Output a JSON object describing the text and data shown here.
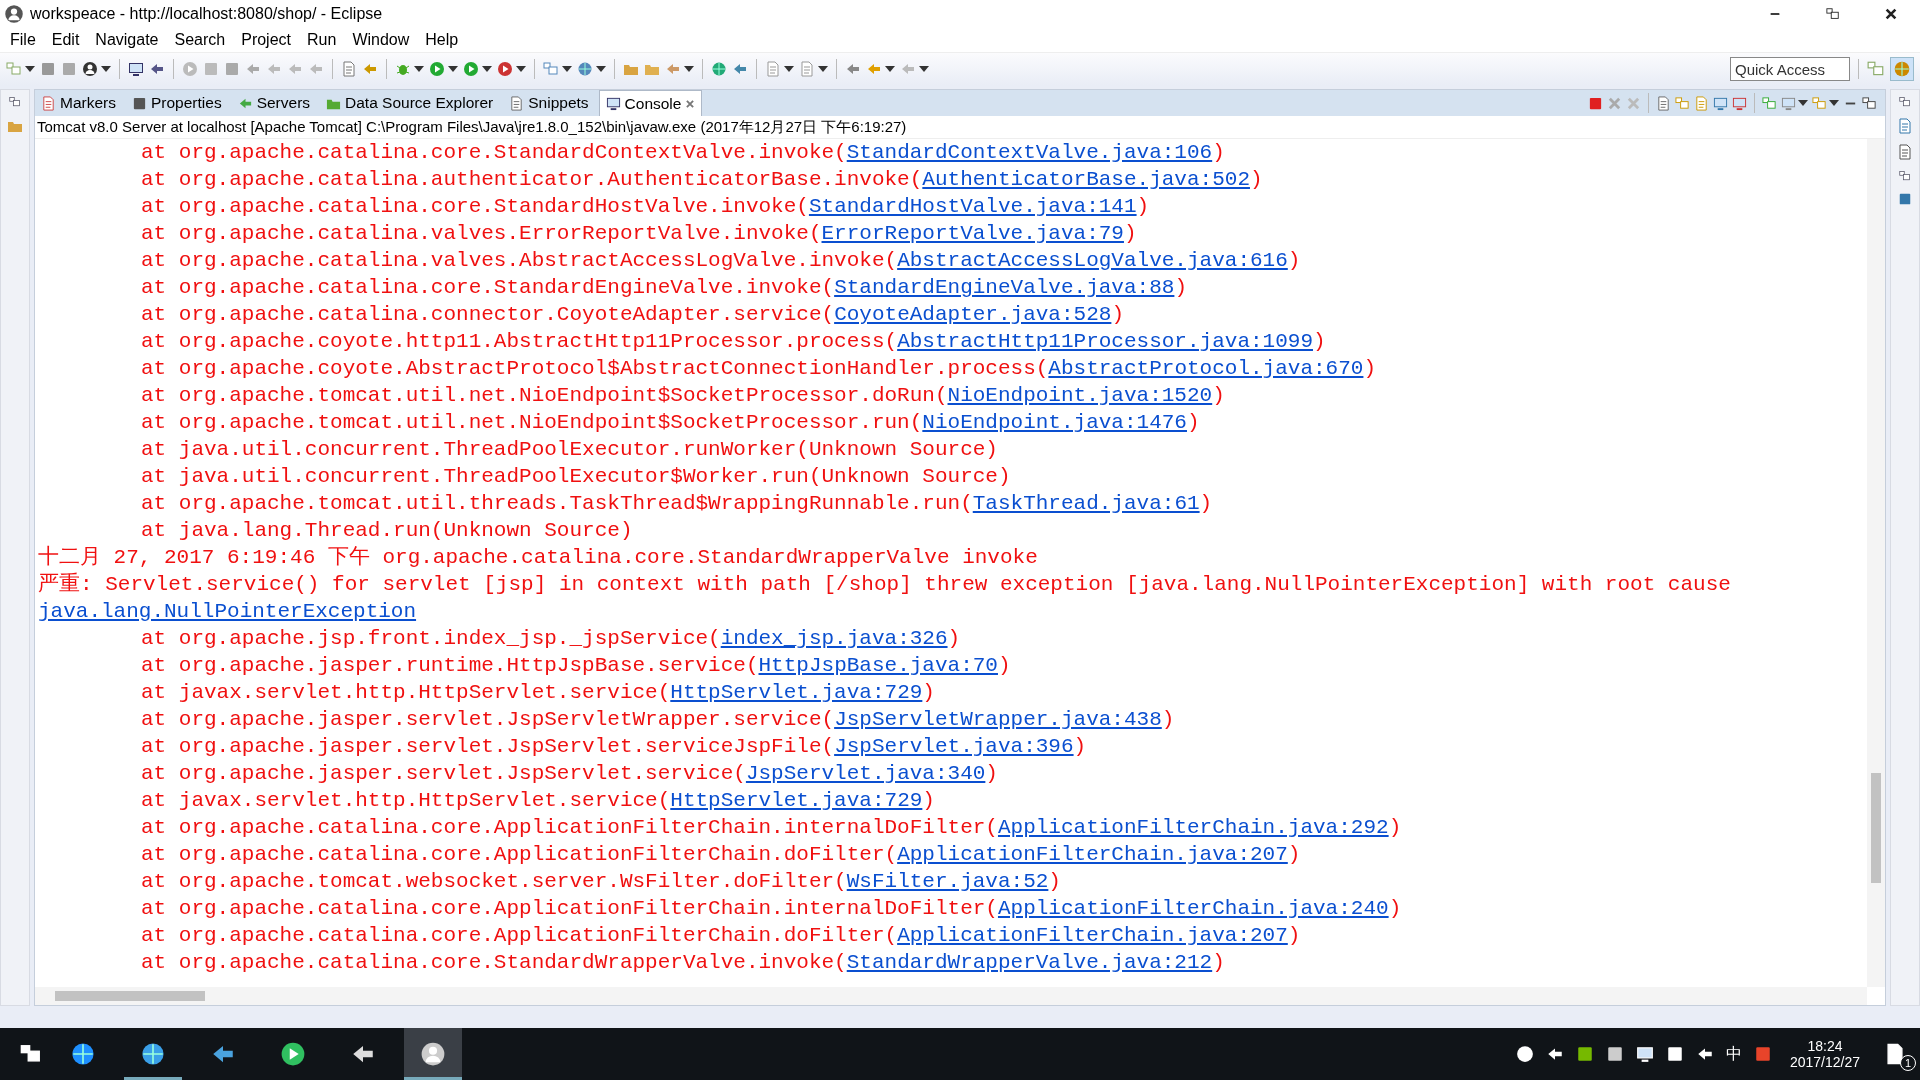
{
  "window": {
    "title": "workspeace - http://localhost:8080/shop/ - Eclipse"
  },
  "menu": [
    "File",
    "Edit",
    "Navigate",
    "Search",
    "Project",
    "Run",
    "Window",
    "Help"
  ],
  "quick_access": {
    "placeholder": "Quick Access"
  },
  "tabs": [
    {
      "label": "Markers",
      "selected": false,
      "closable": false
    },
    {
      "label": "Properties",
      "selected": false,
      "closable": false
    },
    {
      "label": "Servers",
      "selected": false,
      "closable": false
    },
    {
      "label": "Data Source Explorer",
      "selected": false,
      "closable": false
    },
    {
      "label": "Snippets",
      "selected": false,
      "closable": false
    },
    {
      "label": "Console",
      "selected": true,
      "closable": true
    }
  ],
  "console": {
    "header": "Tomcat v8.0 Server at localhost [Apache Tomcat] C:\\Program Files\\Java\\jre1.8.0_152\\bin\\javaw.exe (2017年12月27日 下午6:19:27)",
    "lines": [
      {
        "kind": "frame",
        "text": "at org.apache.catalina.core.StandardContextValve.invoke(",
        "link": "StandardContextValve.java:106",
        "tail": ")"
      },
      {
        "kind": "frame",
        "text": "at org.apache.catalina.authenticator.AuthenticatorBase.invoke(",
        "link": "AuthenticatorBase.java:502",
        "tail": ")"
      },
      {
        "kind": "frame",
        "text": "at org.apache.catalina.core.StandardHostValve.invoke(",
        "link": "StandardHostValve.java:141",
        "tail": ")"
      },
      {
        "kind": "frame",
        "text": "at org.apache.catalina.valves.ErrorReportValve.invoke(",
        "link": "ErrorReportValve.java:79",
        "tail": ")"
      },
      {
        "kind": "frame",
        "text": "at org.apache.catalina.valves.AbstractAccessLogValve.invoke(",
        "link": "AbstractAccessLogValve.java:616",
        "tail": ")"
      },
      {
        "kind": "frame",
        "text": "at org.apache.catalina.core.StandardEngineValve.invoke(",
        "link": "StandardEngineValve.java:88",
        "tail": ")"
      },
      {
        "kind": "frame",
        "text": "at org.apache.catalina.connector.CoyoteAdapter.service(",
        "link": "CoyoteAdapter.java:528",
        "tail": ")"
      },
      {
        "kind": "frame",
        "text": "at org.apache.coyote.http11.AbstractHttp11Processor.process(",
        "link": "AbstractHttp11Processor.java:1099",
        "tail": ")"
      },
      {
        "kind": "frame",
        "text": "at org.apache.coyote.AbstractProtocol$AbstractConnectionHandler.process(",
        "link": "AbstractProtocol.java:670",
        "tail": ")"
      },
      {
        "kind": "frame",
        "text": "at org.apache.tomcat.util.net.NioEndpoint$SocketProcessor.doRun(",
        "link": "NioEndpoint.java:1520",
        "tail": ")"
      },
      {
        "kind": "frame",
        "text": "at org.apache.tomcat.util.net.NioEndpoint$SocketProcessor.run(",
        "link": "NioEndpoint.java:1476",
        "tail": ")"
      },
      {
        "kind": "frame",
        "text": "at java.util.concurrent.ThreadPoolExecutor.runWorker(Unknown Source)"
      },
      {
        "kind": "frame",
        "text": "at java.util.concurrent.ThreadPoolExecutor$Worker.run(Unknown Source)"
      },
      {
        "kind": "frame",
        "text": "at org.apache.tomcat.util.threads.TaskThread$WrappingRunnable.run(",
        "link": "TaskThread.java:61",
        "tail": ")"
      },
      {
        "kind": "frame",
        "text": "at java.lang.Thread.run(Unknown Source)"
      },
      {
        "kind": "log",
        "text": "十二月 27, 2017 6:19:46 下午 org.apache.catalina.core.StandardWrapperValve invoke"
      },
      {
        "kind": "log",
        "text": "严重: Servlet.service() for servlet [jsp] in context with path [/shop] threw exception [java.lang.NullPointerException] with root cause"
      },
      {
        "kind": "link",
        "link": "java.lang.NullPointerException"
      },
      {
        "kind": "frame",
        "text": "at org.apache.jsp.front.index_jsp._jspService(",
        "link": "index_jsp.java:326",
        "tail": ")"
      },
      {
        "kind": "frame",
        "text": "at org.apache.jasper.runtime.HttpJspBase.service(",
        "link": "HttpJspBase.java:70",
        "tail": ")"
      },
      {
        "kind": "frame",
        "text": "at javax.servlet.http.HttpServlet.service(",
        "link": "HttpServlet.java:729",
        "tail": ")"
      },
      {
        "kind": "frame",
        "text": "at org.apache.jasper.servlet.JspServletWrapper.service(",
        "link": "JspServletWrapper.java:438",
        "tail": ")"
      },
      {
        "kind": "frame",
        "text": "at org.apache.jasper.servlet.JspServlet.serviceJspFile(",
        "link": "JspServlet.java:396",
        "tail": ")"
      },
      {
        "kind": "frame",
        "text": "at org.apache.jasper.servlet.JspServlet.service(",
        "link": "JspServlet.java:340",
        "tail": ")"
      },
      {
        "kind": "frame",
        "text": "at javax.servlet.http.HttpServlet.service(",
        "link": "HttpServlet.java:729",
        "tail": ")"
      },
      {
        "kind": "frame",
        "text": "at org.apache.catalina.core.ApplicationFilterChain.internalDoFilter(",
        "link": "ApplicationFilterChain.java:292",
        "tail": ")"
      },
      {
        "kind": "frame",
        "text": "at org.apache.catalina.core.ApplicationFilterChain.doFilter(",
        "link": "ApplicationFilterChain.java:207",
        "tail": ")"
      },
      {
        "kind": "frame",
        "text": "at org.apache.tomcat.websocket.server.WsFilter.doFilter(",
        "link": "WsFilter.java:52",
        "tail": ")"
      },
      {
        "kind": "frame",
        "text": "at org.apache.catalina.core.ApplicationFilterChain.internalDoFilter(",
        "link": "ApplicationFilterChain.java:240",
        "tail": ")"
      },
      {
        "kind": "frame",
        "text": "at org.apache.catalina.core.ApplicationFilterChain.doFilter(",
        "link": "ApplicationFilterChain.java:207",
        "tail": ")"
      },
      {
        "kind": "frame",
        "text": "at org.apache.catalina.core.StandardWrapperValve.invoke(",
        "link": "StandardWrapperValve.java:212",
        "tail": ")"
      }
    ]
  },
  "taskbar": {
    "ime": "中",
    "time": "18:24",
    "date": "2017/12/27",
    "notifications": "1"
  }
}
